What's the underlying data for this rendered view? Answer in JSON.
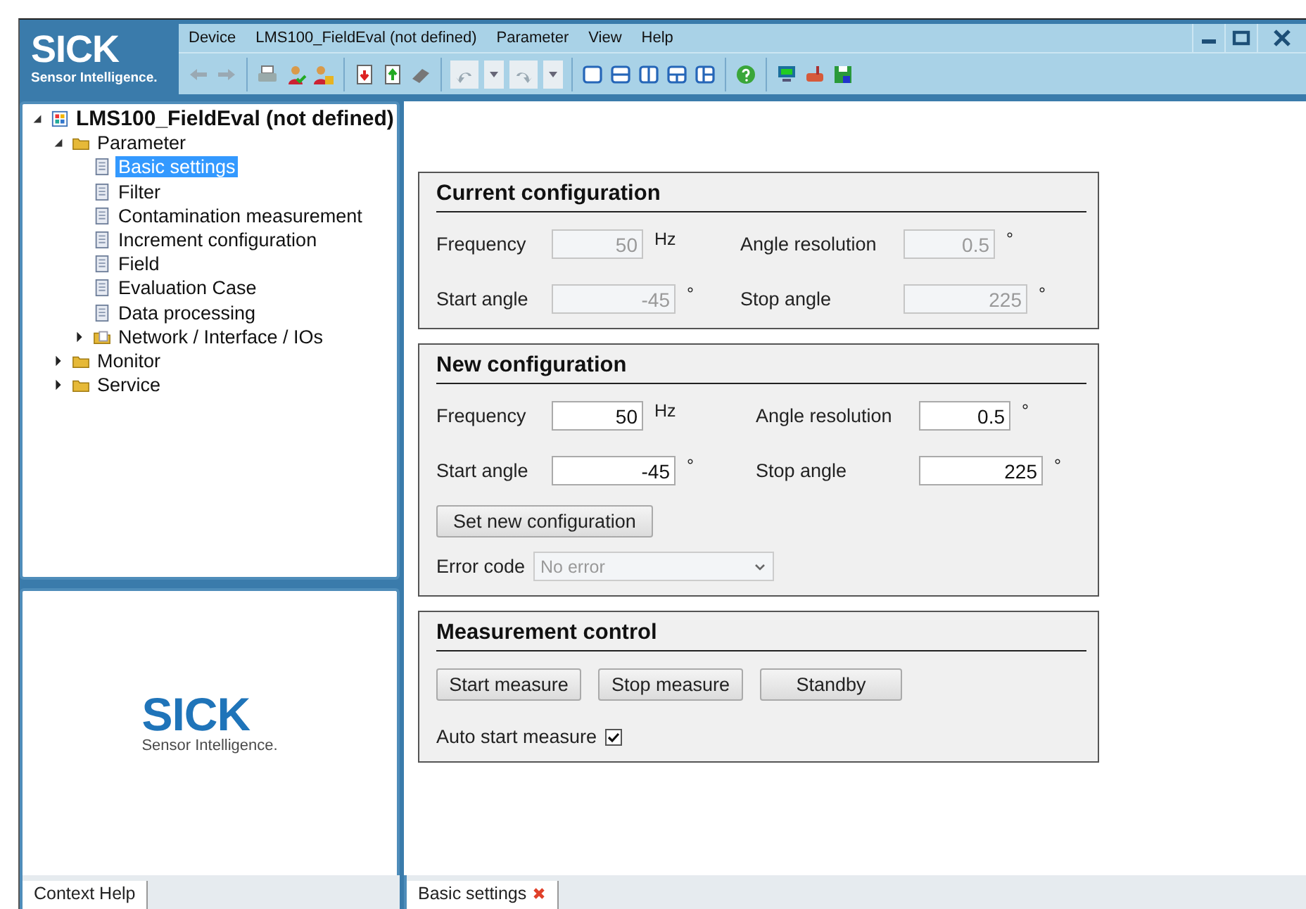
{
  "logo": {
    "brand": "SICK",
    "tagline": "Sensor Intelligence."
  },
  "menu": [
    "Device",
    "LMS100_FieldEval (not defined)",
    "Parameter",
    "View",
    "Help"
  ],
  "tree": [
    {
      "label": "LMS100_FieldEval (not defined)",
      "kind": "device",
      "expanded": true,
      "selected": false,
      "children": [
        {
          "label": "Parameter",
          "kind": "folder",
          "expanded": true,
          "selected": false,
          "children": [
            {
              "label": "Basic settings",
              "kind": "page",
              "selected": true
            },
            {
              "label": "Filter",
              "kind": "page",
              "selected": false
            },
            {
              "label": "Contamination measurement",
              "kind": "page",
              "selected": false
            },
            {
              "label": "Increment configuration",
              "kind": "page",
              "selected": false
            },
            {
              "label": "Field",
              "kind": "page",
              "selected": false
            },
            {
              "label": "Evaluation Case",
              "kind": "page",
              "selected": false
            },
            {
              "label": "Data processing",
              "kind": "page",
              "selected": false
            },
            {
              "label": "Network / Interface / IOs",
              "kind": "openfolder",
              "expanded": false,
              "selected": false
            }
          ]
        },
        {
          "label": "Monitor",
          "kind": "folder",
          "expanded": false,
          "selected": false
        },
        {
          "label": "Service",
          "kind": "folder",
          "expanded": false,
          "selected": false
        }
      ]
    }
  ],
  "help_logo": {
    "brand": "SICK",
    "tagline": "Sensor Intelligence."
  },
  "left_tabs": [
    {
      "label": "Context Help",
      "selected": true
    }
  ],
  "current_configuration": {
    "title": "Current configuration",
    "disabled": true,
    "fields": [
      {
        "label": "Frequency",
        "value": "50",
        "unit": "Hz"
      },
      {
        "label": "Angle resolution",
        "value": "0.5",
        "unit": "°"
      },
      {
        "label": "Start angle",
        "value": "-45",
        "unit": "°"
      },
      {
        "label": "Stop angle",
        "value": "225",
        "unit": "°"
      }
    ]
  },
  "new_configuration": {
    "title": "New configuration",
    "disabled": false,
    "fields": [
      {
        "label": "Frequency",
        "value": "50",
        "unit": "Hz"
      },
      {
        "label": "Angle resolution",
        "value": "0.5",
        "unit": "°"
      },
      {
        "label": "Start angle",
        "value": "-45",
        "unit": "°"
      },
      {
        "label": "Stop angle",
        "value": "225",
        "unit": "°"
      }
    ],
    "button": "Set new configuration",
    "error_code": {
      "label": "Error code",
      "value": "No error",
      "disabled": true
    }
  },
  "measurement_control": {
    "title": "Measurement control",
    "buttons": [
      "Start measure",
      "Stop measure",
      "Standby"
    ],
    "auto_start": {
      "label": "Auto start measure",
      "checked": true
    }
  },
  "right_tabs": [
    {
      "label": "Basic settings",
      "selected": true,
      "closable": true
    }
  ]
}
